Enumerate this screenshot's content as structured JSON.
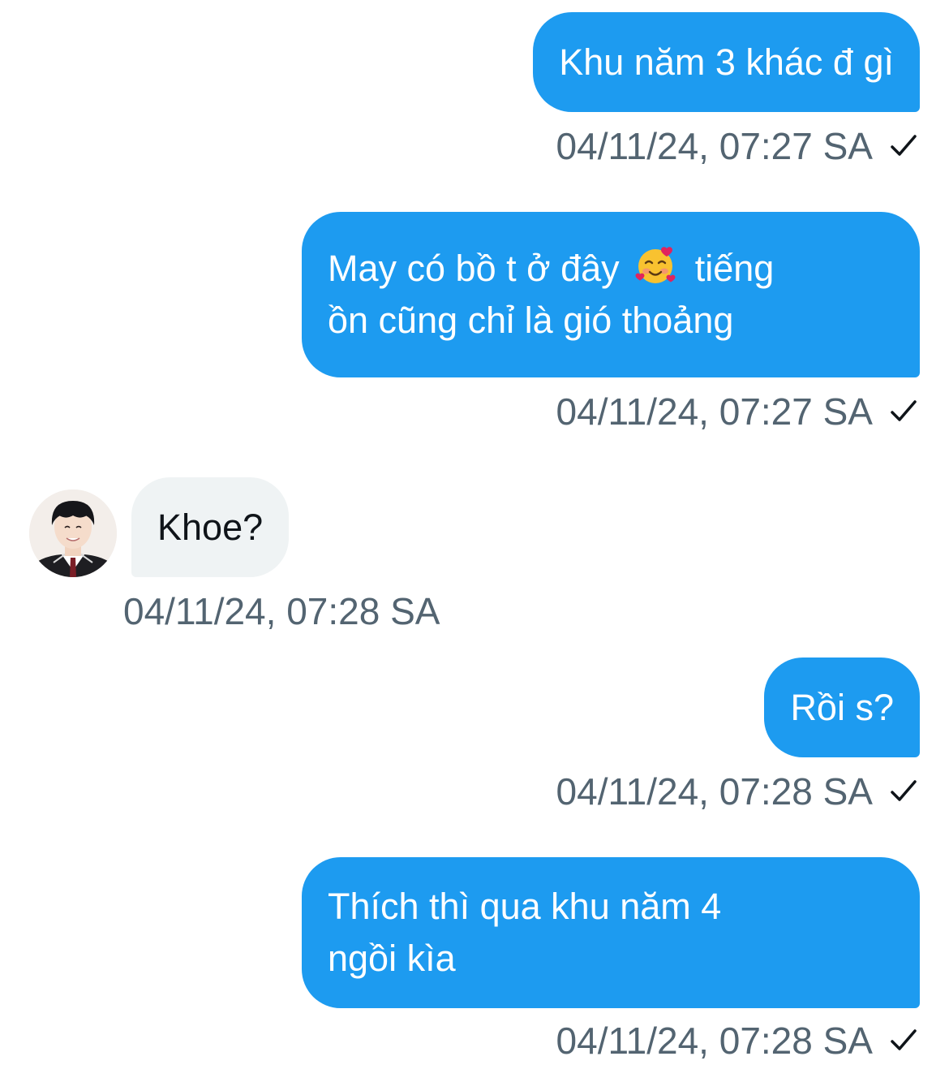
{
  "colors": {
    "outgoing_bubble": "#1d9bf0",
    "incoming_bubble": "#eff3f4",
    "timestamp": "#536471"
  },
  "messages": [
    {
      "direction": "outgoing",
      "lines": [
        "Khu năm 3 khác đ gì"
      ],
      "time": "04/11/24, 07:27 SA",
      "status_icon": "checkmark-icon"
    },
    {
      "direction": "outgoing",
      "lines": [
        "May có bồ t ở đây",
        "tiếng",
        "ồn cũng chỉ là gió thoảng"
      ],
      "emoji": "smiling-face-with-hearts-icon",
      "time": "04/11/24, 07:27 SA",
      "status_icon": "checkmark-icon"
    },
    {
      "direction": "incoming",
      "lines": [
        "Khoe?"
      ],
      "time": "04/11/24, 07:28 SA",
      "avatar": "user-avatar"
    },
    {
      "direction": "outgoing",
      "lines": [
        "Rồi s?"
      ],
      "time": "04/11/24, 07:28 SA",
      "status_icon": "checkmark-icon"
    },
    {
      "direction": "outgoing",
      "lines": [
        "Thích thì qua khu năm 4",
        "ngồi kìa"
      ],
      "time": "04/11/24, 07:28 SA",
      "status_icon": "checkmark-icon"
    }
  ]
}
